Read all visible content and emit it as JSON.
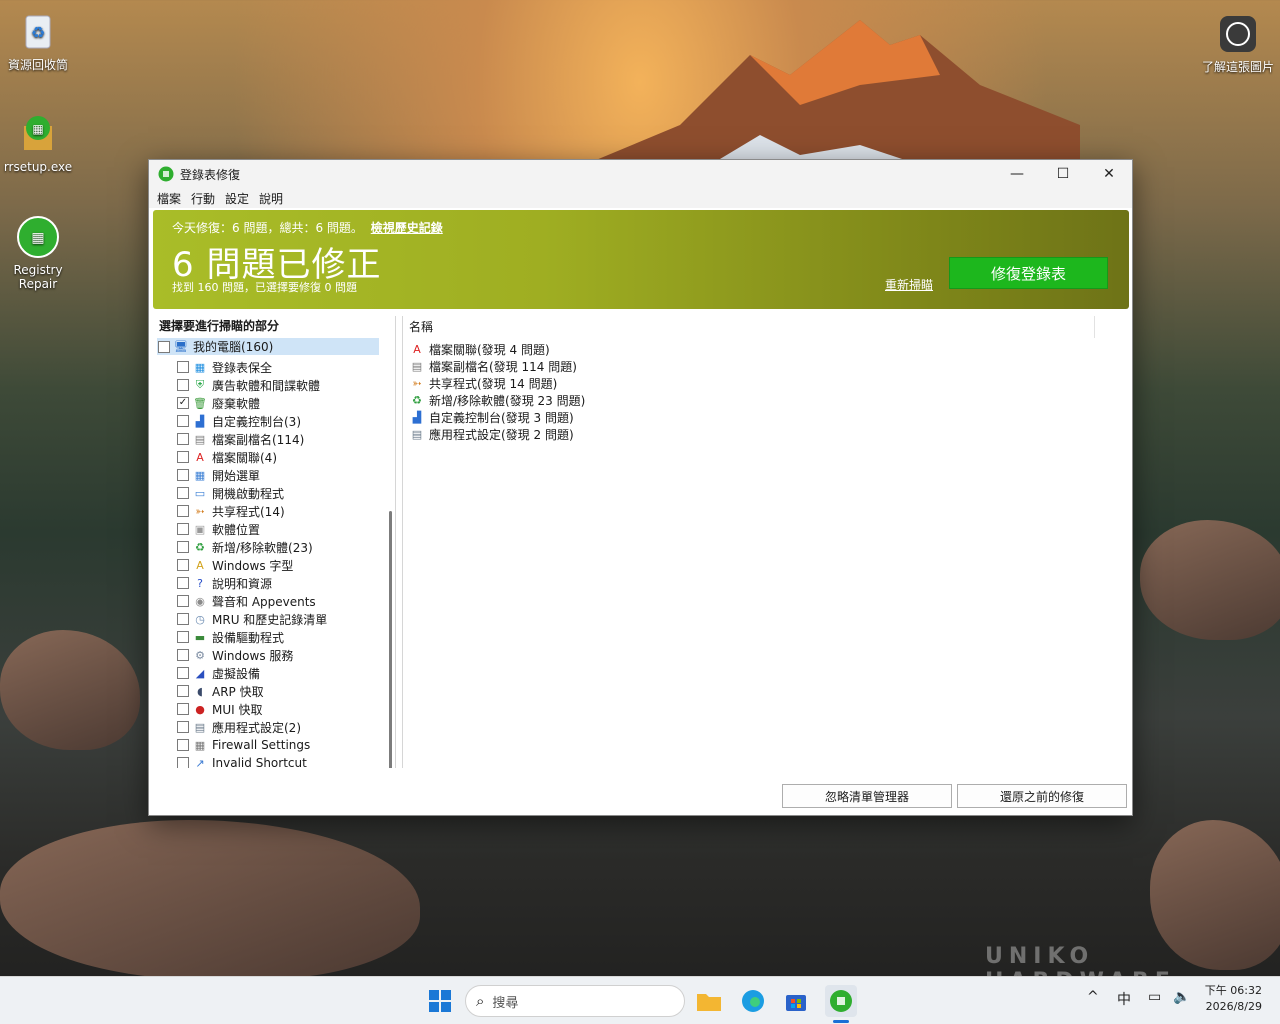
{
  "desktop": {
    "icons": [
      {
        "label": "資源回收筒"
      },
      {
        "label": "rrsetup.exe"
      },
      {
        "label": "Registry\nRepair"
      },
      {
        "label": "了解這張圖片"
      }
    ]
  },
  "window": {
    "title": "登錄表修復",
    "controls": {
      "minimize": "—",
      "maximize": "☐",
      "close": "✕"
    },
    "menu": [
      "檔案",
      "行動",
      "設定",
      "說明"
    ],
    "banner": {
      "today_summary": "今天修復：6 問題，總共：6 問題。",
      "history_link": "檢視歷史記錄",
      "headline": "6 問題已修正",
      "subline": "找到 160 問題，已選擇要修復 0 問題",
      "rescan_link": "重新掃瞄",
      "fix_button": "修復登錄表",
      "accent_color": "#a9bd28",
      "button_color": "#1db71d"
    },
    "left_pane": {
      "header": "選擇要進行掃瞄的部分",
      "root": {
        "label": "我的電腦(160)",
        "checked": false
      },
      "items": [
        {
          "label": "登錄表保全",
          "checked": false,
          "icon": "grid-icon"
        },
        {
          "label": "廣告軟體和間諜軟體",
          "checked": false,
          "icon": "shield-icon"
        },
        {
          "label": "廢棄軟體",
          "checked": true,
          "icon": "trash-icon"
        },
        {
          "label": "自定義控制台(3)",
          "checked": false,
          "icon": "blocks-icon"
        },
        {
          "label": "檔案副檔名(114)",
          "checked": false,
          "icon": "file-icon"
        },
        {
          "label": "檔案關聯(4)",
          "checked": false,
          "icon": "pdf-icon"
        },
        {
          "label": "開始選單",
          "checked": false,
          "icon": "menu-icon"
        },
        {
          "label": "開機啟動程式",
          "checked": false,
          "icon": "window-icon"
        },
        {
          "label": "共享程式(14)",
          "checked": false,
          "icon": "share-icon"
        },
        {
          "label": "軟體位置",
          "checked": false,
          "icon": "folder-icon"
        },
        {
          "label": "新增/移除軟體(23)",
          "checked": false,
          "icon": "recycle-icon"
        },
        {
          "label": "Windows 字型",
          "checked": false,
          "icon": "font-icon"
        },
        {
          "label": "說明和資源",
          "checked": false,
          "icon": "help-icon"
        },
        {
          "label": "聲音和 Appevents",
          "checked": false,
          "icon": "sound-icon"
        },
        {
          "label": "MRU 和歷史記錄清單",
          "checked": false,
          "icon": "history-icon"
        },
        {
          "label": "設備驅動程式",
          "checked": false,
          "icon": "driver-icon"
        },
        {
          "label": "Windows 服務",
          "checked": false,
          "icon": "service-icon"
        },
        {
          "label": "虛擬設備",
          "checked": false,
          "icon": "device-icon"
        },
        {
          "label": "ARP 快取",
          "checked": false,
          "icon": "arp-icon"
        },
        {
          "label": "MUI 快取",
          "checked": false,
          "icon": "mui-icon"
        },
        {
          "label": "應用程式設定(2)",
          "checked": false,
          "icon": "settings-icon"
        },
        {
          "label": "Firewall Settings",
          "checked": false,
          "icon": "firewall-icon"
        },
        {
          "label": "Invalid Shortcut",
          "checked": false,
          "icon": "shortcut-icon"
        }
      ]
    },
    "right_pane": {
      "column_header": "名稱",
      "results": [
        {
          "label": "檔案關聯(發現 4 問題)",
          "icon": "pdf-icon"
        },
        {
          "label": "檔案副檔名(發現 114 問題)",
          "icon": "file-icon"
        },
        {
          "label": "共享程式(發現 14 問題)",
          "icon": "share-icon"
        },
        {
          "label": "新增/移除軟體(發現 23 問題)",
          "icon": "recycle-icon"
        },
        {
          "label": "自定義控制台(發現 3 問題)",
          "icon": "blocks-icon"
        },
        {
          "label": "應用程式設定(發現 2 問題)",
          "icon": "settings-icon"
        }
      ]
    },
    "buttons": {
      "ignore_manager": "忽略清單管理器",
      "restore": "還原之前的修復"
    }
  },
  "watermark": "UNIKO HARDWARE",
  "taskbar": {
    "search_placeholder": "搜尋",
    "tray": {
      "chevron": "^",
      "ime": "中"
    },
    "clock": {
      "time": "下午 06:32",
      "date": "2026/8/29"
    }
  }
}
